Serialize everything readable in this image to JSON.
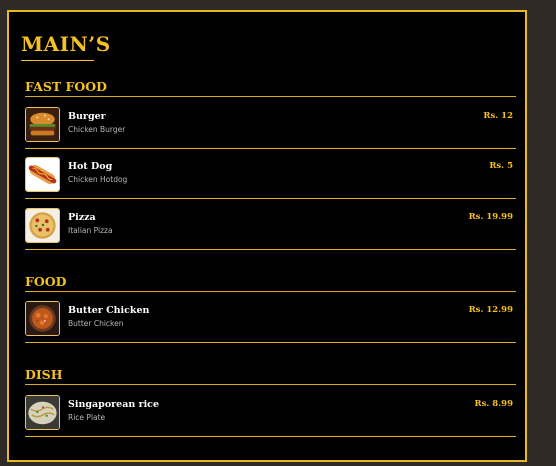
{
  "menu": {
    "title": "MAIN’S",
    "sections": [
      {
        "title": "FAST FOOD",
        "items": [
          {
            "name": "Burger",
            "description": "Chicken Burger",
            "price": "Rs. 12",
            "icon": "burger-icon"
          },
          {
            "name": "Hot Dog",
            "description": "Chicken Hotdog",
            "price": "Rs. 5",
            "icon": "hotdog-icon"
          },
          {
            "name": "Pizza",
            "description": "Italian Pizza",
            "price": "Rs. 19.99",
            "icon": "pizza-icon"
          }
        ]
      },
      {
        "title": "FOOD",
        "items": [
          {
            "name": "Butter Chicken",
            "description": "Butter Chicken",
            "price": "Rs. 12.99",
            "icon": "butter-chicken-icon"
          }
        ]
      },
      {
        "title": "DISH",
        "items": [
          {
            "name": "Singaporean rice",
            "description": "Rice Plate",
            "price": "Rs. 8.99",
            "icon": "rice-plate-icon"
          }
        ]
      }
    ]
  },
  "colors": {
    "accent": "#f5c021",
    "background": "#000000",
    "page_background": "#2f2a26"
  }
}
